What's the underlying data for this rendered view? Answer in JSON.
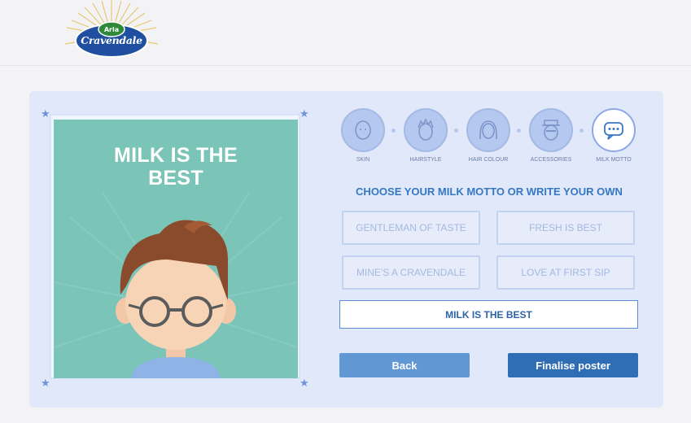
{
  "brand": {
    "name": "Cravendale",
    "parent": "Arla"
  },
  "poster": {
    "motto": "MILK IS THE BEST"
  },
  "steps": [
    {
      "label": "SKIN",
      "icon": "face-icon"
    },
    {
      "label": "HAIRSTYLE",
      "icon": "hairstyle-icon"
    },
    {
      "label": "HAIR COLOUR",
      "icon": "hair-colour-icon"
    },
    {
      "label": "ACCESSORIES",
      "icon": "accessories-icon"
    },
    {
      "label": "MILK MOTTO",
      "icon": "speech-bubble-icon",
      "active": true
    }
  ],
  "heading": "CHOOSE YOUR MILK MOTTO OR WRITE YOUR OWN",
  "options": [
    "GENTLEMAN OF TASTE",
    "FRESH IS BEST",
    "MINE'S A CRAVENDALE",
    "LOVE AT FIRST SIP"
  ],
  "custom_motto": {
    "value": "MILK IS THE BEST"
  },
  "buttons": {
    "back": "Back",
    "finalise": "Finalise poster"
  },
  "colors": {
    "accent": "#2f6eb5",
    "poster_bg": "#7bc5b8",
    "panel": "#e1e8f9"
  }
}
